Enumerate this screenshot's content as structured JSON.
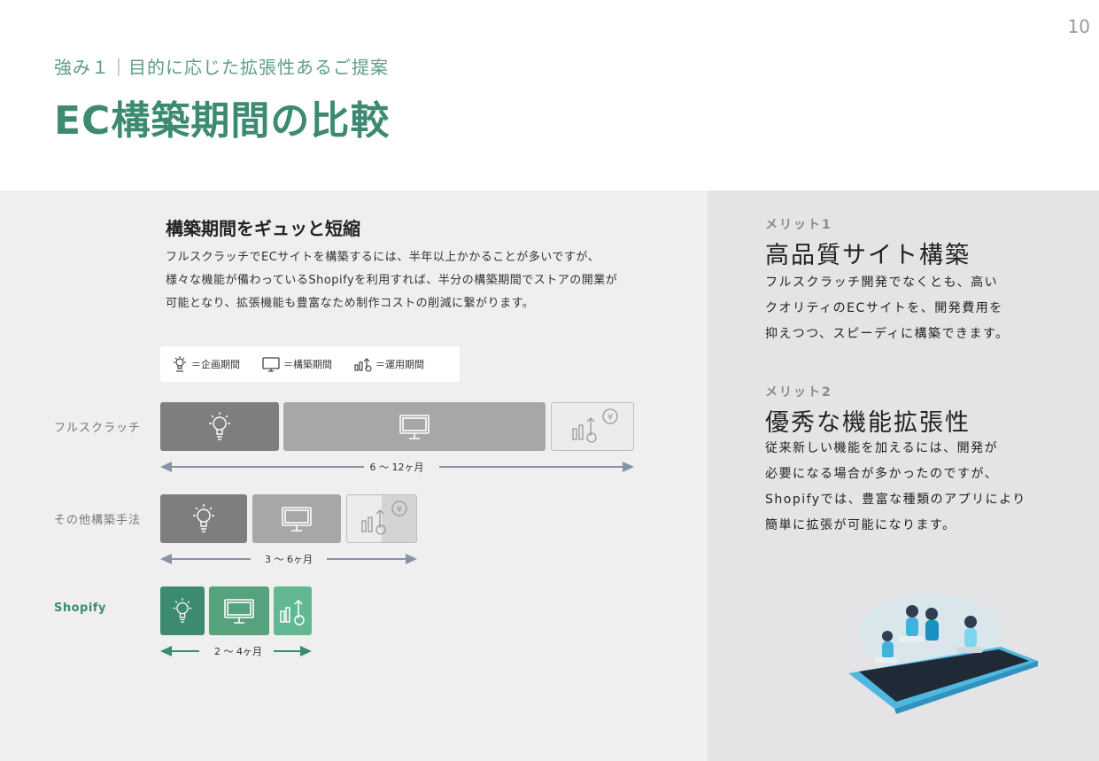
{
  "page_number": "10",
  "subtitle": "強み１｜目的に応じた拡張性あるご提案",
  "title": "EC構築期間の比較",
  "section": {
    "heading": "構築期間をギュッと短縮",
    "body_lines": [
      "フルスクラッチでECサイトを構築するには、半年以上かかることが多いですが、",
      "様々な機能が備わっているShopifyを利用すれば、半分の構築期間でストアの開業が",
      "可能となり、拡張機能も豊富なため制作コストの削減に繋がります。"
    ]
  },
  "legend": {
    "items": [
      {
        "icon": "lightbulb-icon",
        "label": "＝企画期間"
      },
      {
        "icon": "monitor-icon",
        "label": "＝構築期間"
      },
      {
        "icon": "growth-chart-icon",
        "label": "＝運用期間"
      }
    ]
  },
  "rows": [
    {
      "label": "フルスクラッチ",
      "duration": "6 〜 12ヶ月"
    },
    {
      "label": "その他構築手法",
      "duration": "3 〜 6ヶ月"
    },
    {
      "label": "Shopify",
      "duration": "2 〜 4ヶ月"
    }
  ],
  "colors": {
    "accent_green": "#3d8a73",
    "light_green": "#55a27d",
    "gray_dark": "#7e7e7e",
    "gray_mid": "#a7a7a7",
    "arrow_gray": "#8892a8"
  },
  "merits": [
    {
      "tag": "メリット1",
      "title": "高品質サイト構築",
      "body_lines": [
        "フルスクラッチ開発でなくとも、高い",
        "クオリティのECサイトを、開発費用を",
        "抑えつつ、スピーディに構築できます。"
      ]
    },
    {
      "tag": "メリット2",
      "title": "優秀な機能拡張性",
      "body_lines": [
        "従来新しい機能を加えるには、開発が",
        "必要になる場合が多かったのですが、",
        "Shopifyでは、豊富な種類のアプリにより",
        "簡単に拡張が可能になります。"
      ]
    }
  ]
}
